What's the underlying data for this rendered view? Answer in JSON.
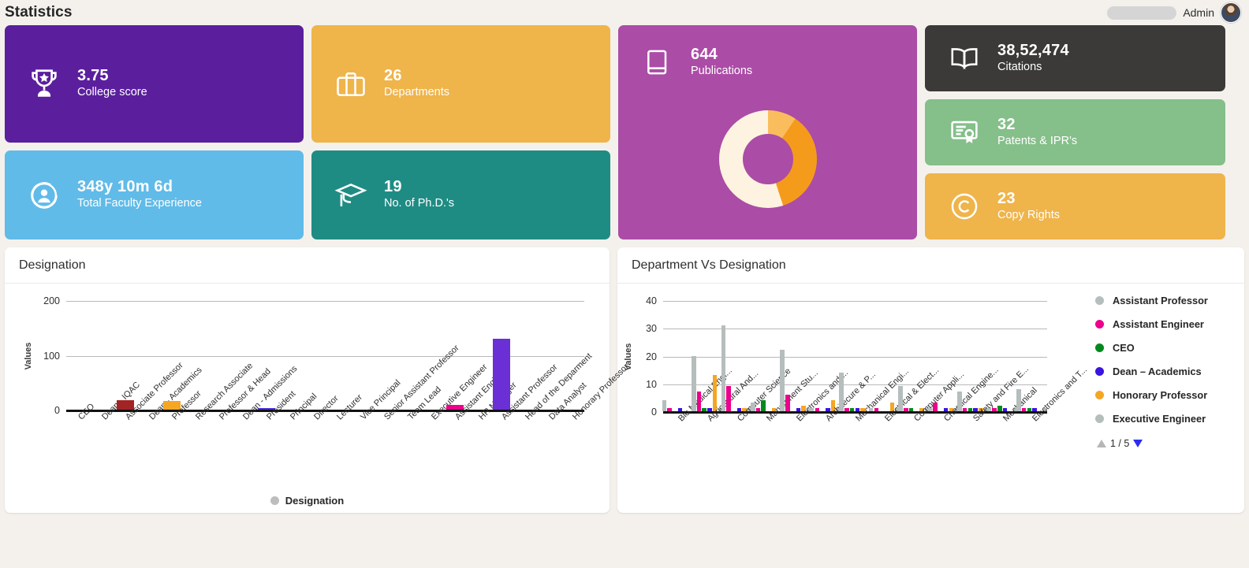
{
  "header": {
    "title": "Statistics",
    "admin_label": "Admin",
    "avatar_name": "user-avatar"
  },
  "kpis": [
    {
      "id": "college-score",
      "value": "3.75",
      "label": "College score",
      "color": "#5b1f9e",
      "icon": "trophy-star-icon"
    },
    {
      "id": "total-faculty-experience",
      "value": "348y 10m 6d",
      "label": "Total Faculty Experience",
      "color": "#60bbe8",
      "icon": "user-circle-icon"
    },
    {
      "id": "departments",
      "value": "26",
      "label": "Departments",
      "color": "#efb košu"
    },
    {
      "id": "phds",
      "value": "19",
      "label": "No. of Ph.D.'s",
      "color": "#1f8c84",
      "icon": "graduation-cap-icon"
    },
    {
      "id": "publications",
      "value": "644",
      "label": "Publications",
      "color": "#ab4ca6",
      "icon": "book-icon"
    },
    {
      "id": "citations",
      "value": "38,52,474",
      "label": "Citations",
      "color": "#3b3a38",
      "icon": "open-book-icon"
    },
    {
      "id": "patents",
      "value": "32",
      "label": "Patents & IPR's",
      "color": "#85bf8a",
      "icon": "certificate-icon"
    },
    {
      "id": "copyrights",
      "value": "23",
      "label": "Copy Rights",
      "color": "#efb44a",
      "icon": "copyright-icon"
    }
  ],
  "cards": {
    "college_score": {
      "value": "3.75",
      "label": "College score"
    },
    "faculty_experience": {
      "value": "348y 10m 6d",
      "label": "Total Faculty Experience"
    },
    "departments": {
      "value": "26",
      "label": "Departments"
    },
    "phds": {
      "value": "19",
      "label": "No. of Ph.D.'s"
    },
    "publications": {
      "value": "644",
      "label": "Publications"
    },
    "citations": {
      "value": "38,52,474",
      "label": "Citations"
    },
    "patents": {
      "value": "32",
      "label": "Patents & IPR's"
    },
    "copyrights": {
      "value": "23",
      "label": "Copy Rights"
    }
  },
  "panels": {
    "designation_title": "Designation",
    "department_title": "Department Vs Designation"
  },
  "chart_data": [
    {
      "id": "designation-chart",
      "type": "bar",
      "title": "Designation",
      "xlabel": "",
      "ylabel": "Values",
      "ylim": [
        0,
        200
      ],
      "yticks": [
        0,
        100,
        200
      ],
      "grid": true,
      "legend": [
        {
          "name": "Designation",
          "color": "#bdbdbd"
        }
      ],
      "legend_position": "bottom",
      "categories": [
        "CEO",
        "Dean - IQAC",
        "Associate Professor",
        "Dean - Academics",
        "Professor",
        "Research Associate",
        "Professor & Head",
        "Dean - Admissions",
        "President",
        "Principal",
        "Director",
        "Lecturer",
        "Vice Principal",
        "Senior Assistant Professor",
        "Team Lead",
        "Executive Engineer",
        "Assistant Engineer",
        "HR Manager",
        "Assistant Professor",
        "Head of the Deparment",
        "Data Analyst",
        "Honorary Professor"
      ],
      "values": [
        0,
        0,
        18,
        0,
        16,
        0,
        0,
        0,
        3,
        0,
        0,
        0,
        0,
        0,
        0,
        0,
        8,
        0,
        130,
        0,
        0,
        0
      ],
      "colors": [
        "#b02a2a",
        "#b02a2a",
        "#a32424",
        "#e8a33a",
        "#f5a623",
        "#e8a33a",
        "#6b2fd6",
        "#4b2fd6",
        "#4b2fd6",
        "#6b2fd6",
        "#6b2fd6",
        "#6b2fd6",
        "#6b2fd6",
        "#6b2fd6",
        "#6b2fd6",
        "#6b2fd6",
        "#ec008c",
        "#ec008c",
        "#6b2fd6",
        "#6b2fd6",
        "#6b2fd6",
        "#6b2fd6"
      ]
    },
    {
      "id": "department-vs-designation-chart",
      "type": "bar",
      "title": "Department Vs Designation",
      "xlabel": "",
      "ylabel": "Values",
      "ylim": [
        0,
        40
      ],
      "yticks": [
        0,
        10,
        20,
        30,
        40
      ],
      "grid": true,
      "legend_position": "right",
      "legend_page": "1 / 5",
      "legend": [
        {
          "name": "Assistant Professor",
          "color": "#b5bdbd"
        },
        {
          "name": "Assistant Engineer",
          "color": "#ec008c"
        },
        {
          "name": "CEO",
          "color": "#008a1e"
        },
        {
          "name": "Dean – Academics",
          "color": "#3a14e0"
        },
        {
          "name": "Honorary Professor",
          "color": "#f5a623"
        },
        {
          "name": "Executive Engineer",
          "color": "#b5bdbd"
        }
      ],
      "categories": [
        "Bio Medical Engi...",
        "Agricultural And...",
        "Computer Science",
        "Managment Stu...",
        "Electronics and ...",
        "Architecure & P...",
        "Mechanical Engi...",
        "Electrical & Elect...",
        "Computer Appli...",
        "Chemical Engine...",
        "Safety and Fire E...",
        "Mechanical",
        "Electronics and T..."
      ],
      "series": [
        {
          "name": "Assistant Professor",
          "color": "#b5bdbd",
          "values": [
            4,
            20,
            31,
            3,
            22,
            1,
            14,
            1,
            9,
            1,
            7,
            1,
            8
          ]
        },
        {
          "name": "Assistant Engineer",
          "color": "#ec008c",
          "values": [
            1,
            7,
            9,
            1,
            6,
            1,
            1,
            1,
            1,
            3,
            1,
            1,
            1
          ]
        },
        {
          "name": "CEO",
          "color": "#008a1e",
          "values": [
            0,
            1,
            0,
            4,
            0,
            0,
            1,
            0,
            1,
            0,
            1,
            2,
            1
          ]
        },
        {
          "name": "Dean – Academics",
          "color": "#3a14e0",
          "values": [
            1,
            1,
            1,
            0,
            1,
            1,
            1,
            0,
            0,
            1,
            1,
            1,
            1
          ]
        },
        {
          "name": "Honorary Professor",
          "color": "#f5a623",
          "values": [
            0,
            13,
            1,
            1,
            2,
            4,
            1,
            3,
            1,
            1,
            1,
            0,
            0
          ]
        },
        {
          "name": "Executive Engineer",
          "color": "#b5bdbd",
          "values": [
            0,
            1,
            1,
            0,
            1,
            1,
            0,
            1,
            1,
            1,
            1,
            1,
            1
          ]
        }
      ]
    }
  ]
}
